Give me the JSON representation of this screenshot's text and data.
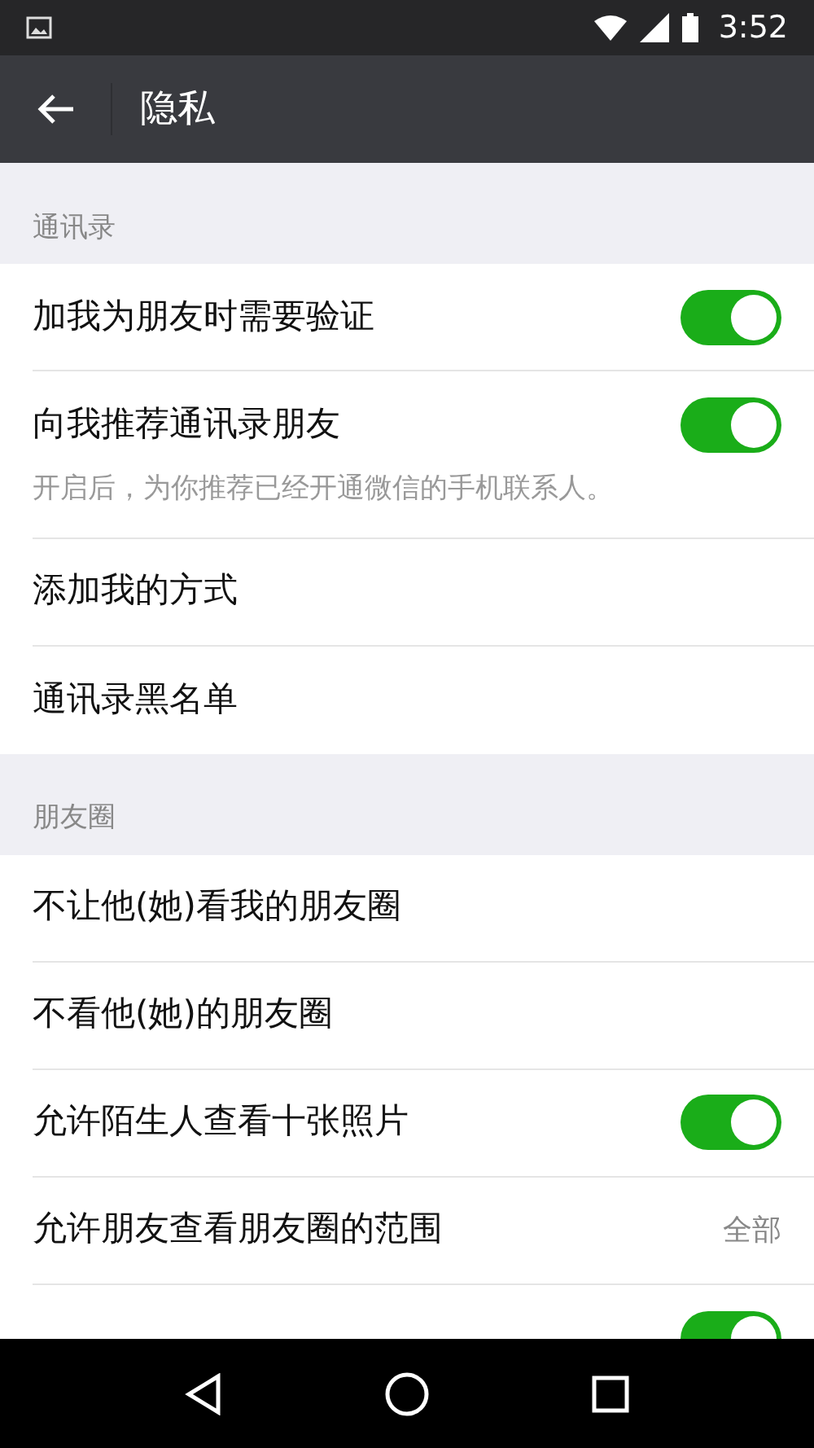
{
  "status_bar": {
    "time": "3:52"
  },
  "toolbar": {
    "title": "隐私"
  },
  "sections": [
    {
      "header": "通讯录",
      "rows": [
        {
          "kind": "toggle",
          "label": "加我为朋友时需要验证",
          "on": true
        },
        {
          "kind": "toggle",
          "label": "向我推荐通讯录朋友",
          "on": true,
          "description": "开启后，为你推荐已经开通微信的手机联系人。"
        },
        {
          "kind": "link",
          "label": "添加我的方式"
        },
        {
          "kind": "link",
          "label": "通讯录黑名单"
        }
      ]
    },
    {
      "header": "朋友圈",
      "rows": [
        {
          "kind": "link",
          "label": "不让他(她)看我的朋友圈"
        },
        {
          "kind": "link",
          "label": "不看他(她)的朋友圈"
        },
        {
          "kind": "toggle",
          "label": "允许陌生人查看十张照片",
          "on": true
        },
        {
          "kind": "value",
          "label": "允许朋友查看朋友圈的范围",
          "value": "全部"
        },
        {
          "kind": "toggle",
          "on": true
        }
      ]
    }
  ]
}
